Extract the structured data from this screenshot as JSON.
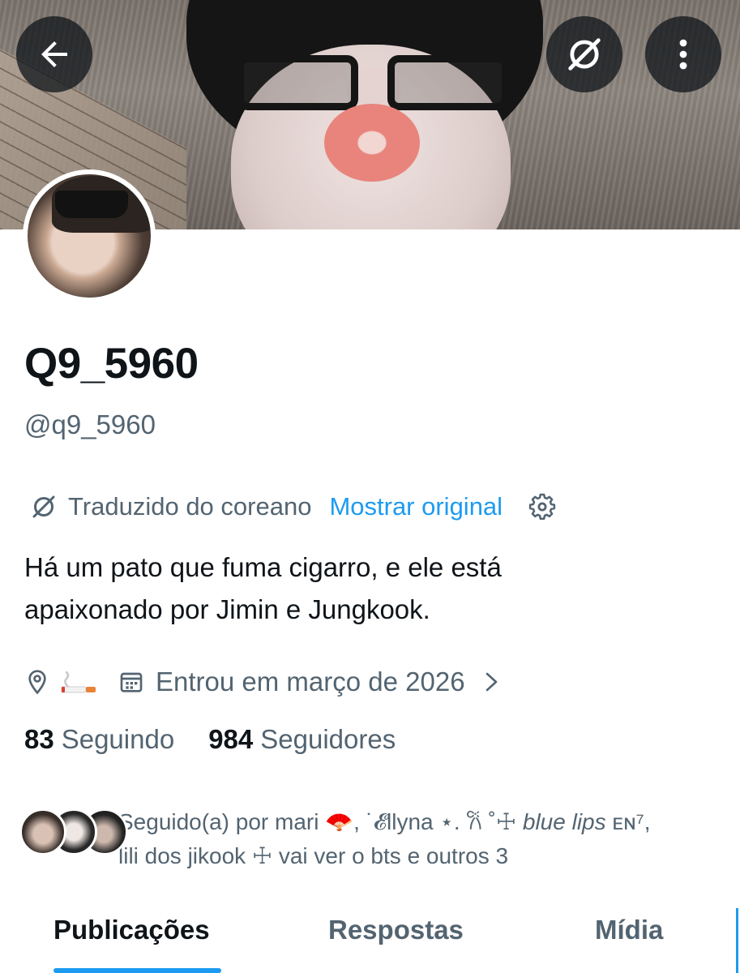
{
  "header": {
    "back_icon": "arrow-left-icon",
    "translate_icon": "translate-slash-icon",
    "more_icon": "more-vertical-icon",
    "button_bg": "#0f1419"
  },
  "profile": {
    "display_name": "Q9_5960",
    "handle": "@q9_5960"
  },
  "translation": {
    "notice": "Traduzido do coreano",
    "show_original": "Mostrar original"
  },
  "bio": {
    "line1": "Há um pato que fuma cigarro, e ele está",
    "line2": "apaixonado por Jimin e Jungkook."
  },
  "meta": {
    "location_icon": "location-pin-icon",
    "location_emoji": "cigarette-emoji",
    "joined_icon": "calendar-icon",
    "joined": "Entrou em março de 2026"
  },
  "stats": {
    "following_count": "83",
    "following_label": "Seguindo",
    "followers_count": "984",
    "followers_label": "Seguidores"
  },
  "followed_by": {
    "prefix": "Seguido(a) por mari ",
    "fan": "🪭",
    "mid": ", ˙𝓔llyna ⋆. 𐙚 ˚☩ ",
    "blue": "blue lips",
    "suffix": " ᴇɴ⁷,",
    "line2": "lili dos jikook ☩ vai ver o bts e outros 3"
  },
  "tabs": [
    {
      "label": "Publicações",
      "active": true
    },
    {
      "label": "Respostas",
      "active": false
    },
    {
      "label": "Mídia",
      "active": false
    }
  ],
  "colors": {
    "accent": "#1d9bf0",
    "text_primary": "#0f1419",
    "text_secondary": "#536471"
  }
}
